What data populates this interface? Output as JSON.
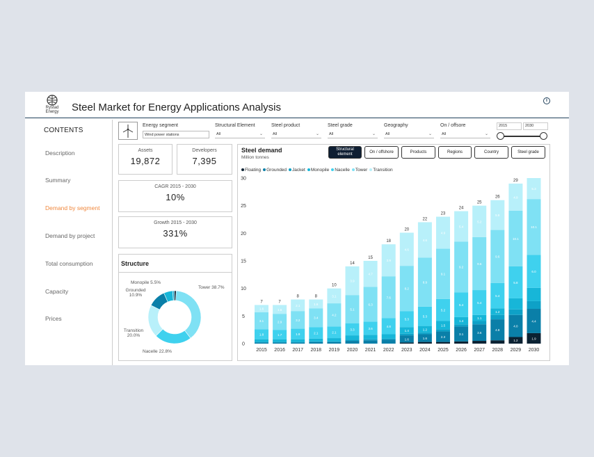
{
  "app": {
    "logo_text_1": "Rystad",
    "logo_text_2": "Energy",
    "title": "Steel Market for Energy Applications Analysis"
  },
  "sidebar": {
    "title": "CONTENTS",
    "items": [
      {
        "label": "Description",
        "active": false
      },
      {
        "label": "Summary",
        "active": false
      },
      {
        "label": "Demand by segment",
        "active": true
      },
      {
        "label": "Demand by project",
        "active": false
      },
      {
        "label": "Total consumption",
        "active": false
      },
      {
        "label": "Capacity",
        "active": false
      },
      {
        "label": "Prices",
        "active": false
      }
    ]
  },
  "filters": [
    {
      "label": "Energy segment",
      "value": "Wind power stations"
    },
    {
      "label": "Structural Element",
      "value": "All"
    },
    {
      "label": "Steel product",
      "value": "All"
    },
    {
      "label": "Steel grade",
      "value": "All"
    },
    {
      "label": "Geography",
      "value": "All"
    },
    {
      "label": "On / offsore",
      "value": "All"
    }
  ],
  "year_range": {
    "from": "2015",
    "to": "2030"
  },
  "kpis": {
    "assets": {
      "label": "Assets",
      "value": "19,872"
    },
    "developers": {
      "label": "Developers",
      "value": "7,395"
    },
    "cagr": {
      "label": "CAGR 2015 - 2030",
      "value": "10%"
    },
    "growth": {
      "label": "Growth 2015 - 2030",
      "value": "331%"
    }
  },
  "structure": {
    "title": "Structure",
    "slices": [
      {
        "name": "Tower",
        "label": "Tower 38.7%",
        "value": 38.7,
        "color": "#7fe1f4"
      },
      {
        "name": "Nacelle",
        "label": "Nacelle 22.8%",
        "value": 22.8,
        "color": "#3fd1ee"
      },
      {
        "name": "Transition",
        "label": "Transition 20.0%",
        "value": 20.0,
        "color": "#b8f0fa"
      },
      {
        "name": "Grounded",
        "label": "Grounded 10.9%",
        "value": 10.9,
        "color": "#0a7fa8"
      },
      {
        "name": "Monopile",
        "label": "Monopile 5.5%",
        "value": 5.5,
        "color": "#17b6d8"
      },
      {
        "name": "Jacket",
        "value": 1.0,
        "color": "#0ea1c7"
      },
      {
        "name": "Floating",
        "value": 1.1,
        "color": "#0b2233"
      }
    ]
  },
  "chart_buttons": [
    {
      "label": "Structural element",
      "selected": true
    },
    {
      "label": "On / offshore",
      "selected": false
    },
    {
      "label": "Products",
      "selected": false
    },
    {
      "label": "Regions",
      "selected": false
    },
    {
      "label": "Country",
      "selected": false
    },
    {
      "label": "Steel grade",
      "selected": false
    }
  ],
  "chart_data": {
    "type": "bar",
    "stacked": true,
    "title": "Steel demand",
    "subtitle": "Million tonnes",
    "ylim": [
      0,
      30
    ],
    "yticks": [
      0,
      5,
      10,
      15,
      20,
      25,
      30
    ],
    "legend_position": "top-left",
    "categories": [
      "2015",
      "2016",
      "2017",
      "2018",
      "2019",
      "2020",
      "2021",
      "2022",
      "2023",
      "2024",
      "2025",
      "2026",
      "2027",
      "2028",
      "2029",
      "2030"
    ],
    "totals": [
      7,
      7,
      8,
      8,
      10,
      14,
      15,
      18,
      20,
      22,
      23,
      24,
      25,
      26,
      29,
      30
    ],
    "series": [
      {
        "name": "Floating",
        "color": "#0b2233",
        "values": [
          0,
          0,
          0,
          0,
          0,
          0,
          0,
          0,
          0.2,
          0.3,
          0.3,
          0.4,
          0.5,
          0.6,
          1.2,
          1.9
        ],
        "labels": [
          "",
          "",
          "",
          "",
          "",
          "",
          "",
          "",
          "",
          "",
          "",
          "",
          "",
          "",
          "1.2",
          "1.9"
        ]
      },
      {
        "name": "Grounded",
        "color": "#0a7fa8",
        "values": [
          0.2,
          0.2,
          0.2,
          0.3,
          0.3,
          0.5,
          0.6,
          0.7,
          1.3,
          1.4,
          1.9,
          2.7,
          3.0,
          3.8,
          4.0,
          4.4
        ],
        "labels": [
          "",
          "",
          "",
          "",
          "",
          "",
          "",
          "",
          "1.6",
          "1.6",
          "2.3",
          "3.1",
          "3.6",
          "4.8",
          "4.0",
          "4.4"
        ]
      },
      {
        "name": "Jacket",
        "color": "#0ea1c7",
        "values": [
          0.1,
          0.1,
          0.1,
          0.1,
          0.1,
          0.2,
          0.2,
          0.2,
          0.3,
          0.3,
          0.4,
          0.4,
          0.6,
          0.8,
          1.0,
          1.4
        ],
        "labels": [
          "",
          "",
          "",
          "",
          "",
          "",
          "",
          "",
          "",
          "",
          "",
          "",
          "",
          "",
          "",
          ""
        ]
      },
      {
        "name": "Monopile",
        "color": "#17b6d8",
        "values": [
          0.5,
          0.5,
          0.5,
          0.5,
          0.6,
          0.8,
          0.8,
          0.8,
          1.2,
          1.2,
          1.5,
          1.3,
          1.1,
          1.2,
          2.0,
          2.4
        ],
        "labels": [
          "",
          "",
          "",
          "",
          "",
          "",
          "",
          "",
          "1.4",
          "1.2",
          "1.5",
          "1.4",
          "1.1",
          "1.2",
          "",
          ""
        ]
      },
      {
        "name": "Nacelle",
        "color": "#3fd1ee",
        "values": [
          1.8,
          1.7,
          1.9,
          2.1,
          2.1,
          2.2,
          2.4,
          2.9,
          2.9,
          3.5,
          4.0,
          4.5,
          4.5,
          4.6,
          5.8,
          6.0
        ],
        "labels": [
          "1.8",
          "1.7",
          "1.9",
          "2.1",
          "2.1",
          "3.3",
          "3.6",
          "4.8",
          "5.3",
          "5.3",
          "5.2",
          "5.4",
          "5.4",
          "5.4",
          "5.8",
          "6.0"
        ]
      },
      {
        "name": "Tower",
        "color": "#7fe1f4",
        "values": [
          3.1,
          2.9,
          3.2,
          3.4,
          4.2,
          5.1,
          6.3,
          7.6,
          8.2,
          8.9,
          9.1,
          9.2,
          9.6,
          9.6,
          10.1,
          10.1
        ],
        "labels": [
          "3.1",
          "2.9",
          "3.2",
          "3.4",
          "4.2",
          "5.1",
          "6.3",
          "7.6",
          "8.2",
          "8.9",
          "9.1",
          "9.2",
          "9.6",
          "9.6",
          "10.1",
          "10.1"
        ]
      },
      {
        "name": "Transition",
        "color": "#b8f0fa",
        "values": [
          1.3,
          1.6,
          2.1,
          1.6,
          2.7,
          5.2,
          4.7,
          5.8,
          6.0,
          6.4,
          5.8,
          5.5,
          5.7,
          5.4,
          4.9,
          3.8
        ],
        "labels": [
          "1.6",
          "1.6",
          "2.1",
          "1.6",
          "3.1",
          "3.9",
          "4.7",
          "3.9",
          "4.6",
          "4.6",
          "4.9",
          "5.4",
          "5.2",
          "5.8",
          "4.9",
          "5.3"
        ]
      }
    ]
  }
}
